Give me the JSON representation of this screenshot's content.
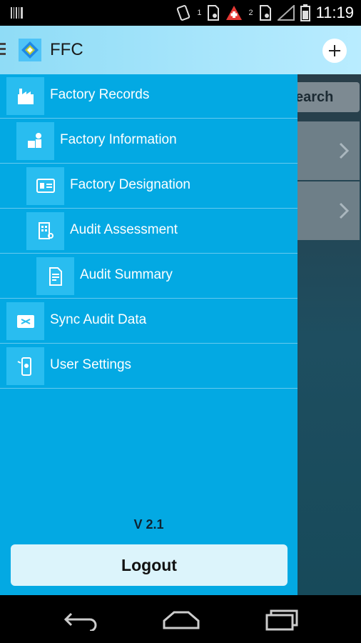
{
  "status_bar": {
    "time": "11:19",
    "sim1_label": "1",
    "sim2_label": "2",
    "icons": [
      "barcode-icon",
      "vibrate-icon",
      "sim1-icon",
      "warning-icon",
      "sim2-icon",
      "signal-icon",
      "battery-icon"
    ]
  },
  "app_bar": {
    "title": "FFC",
    "add_icon": "plus-icon",
    "menu_icon": "hamburger-icon"
  },
  "background": {
    "search_label": "earch"
  },
  "drawer": {
    "items": [
      {
        "label": "Factory Records",
        "icon": "factory-icon"
      },
      {
        "label": "Factory Information",
        "icon": "info-icon"
      },
      {
        "label": "Factory Designation",
        "icon": "id-card-icon"
      },
      {
        "label": "Audit Assessment",
        "icon": "assessment-icon"
      },
      {
        "label": "Audit Summary",
        "icon": "summary-icon"
      },
      {
        "label": "Sync Audit Data",
        "icon": "sync-icon"
      },
      {
        "label": "User Settings",
        "icon": "settings-phone-icon"
      }
    ],
    "version": "V 2.1",
    "logout_label": "Logout"
  },
  "colors": {
    "drawer_bg": "#03a9e3",
    "icon_box_bg": "#29bdf0",
    "app_bar_bg": "#b9ecff"
  }
}
